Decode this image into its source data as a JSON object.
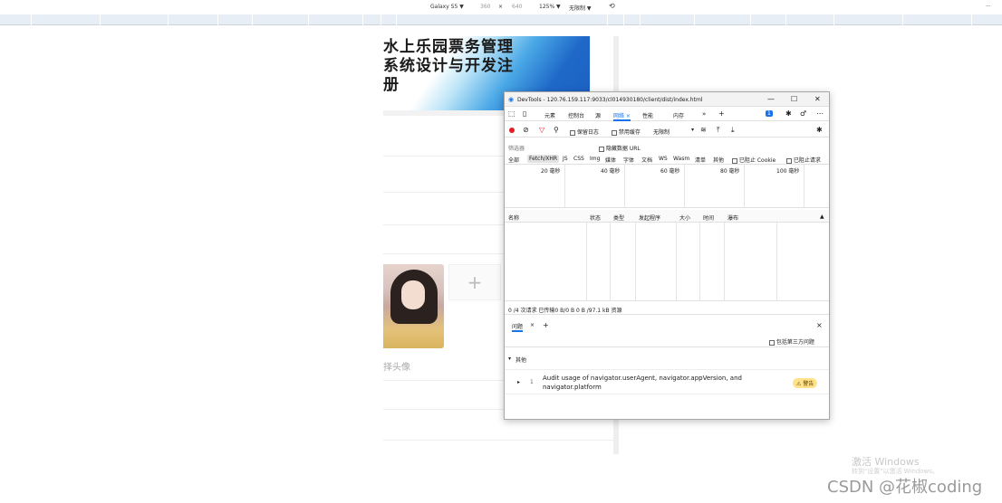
{
  "device_toolbar": {
    "device": "Galaxy S5 ▼",
    "width": "360",
    "times": "×",
    "height": "640",
    "zoom": "125% ▼",
    "throttle": "无限制 ▼",
    "more": "···"
  },
  "page": {
    "banner_title": "水上乐园票务管理系统设计与开发注册",
    "add_icon": "+",
    "avatar_label": "择头像"
  },
  "devtools": {
    "title": "DevTools - 120.76.159.117:9033/cl014930180/client/dist/index.html",
    "window_controls": {
      "minimize": "—",
      "maximize": "☐",
      "close": "✕"
    },
    "tabs": [
      "元素",
      "控制台",
      "源",
      "网络 ×",
      "性能",
      "内存",
      "»",
      "+"
    ],
    "issue_count": "1",
    "net_toolbar": {
      "preserve_log": "保留日志",
      "disable_cache": "禁用缓存",
      "throttle": "无限制"
    },
    "filter": {
      "placeholder": "筛选器",
      "hide_data_urls": "隐藏数据 URL"
    },
    "types": [
      "全部",
      "Fetch/XHR",
      "JS",
      "CSS",
      "Img",
      "媒体",
      "字体",
      "文档",
      "WS",
      "Wasm",
      "清单",
      "其他"
    ],
    "blocked_cookies": "已阻止 Cookie",
    "blocked_requests": "已阻止请求",
    "timeline_ticks": [
      "20 毫秒",
      "40 毫秒",
      "60 毫秒",
      "80 毫秒",
      "100 毫秒"
    ],
    "columns": [
      "名称",
      "状态",
      "类型",
      "发起程序",
      "大小",
      "时间",
      "瀑布"
    ],
    "status": "0 /4 次请求  已传输0 B/0 B  0 B /97.1 kB 资源",
    "issues": {
      "tab": "问题",
      "close": "×",
      "add": "+",
      "include_third_party": "包括第三方问题",
      "group": "其他",
      "issue_count": "1",
      "issue_text": "Audit usage of navigator.userAgent, navigator.appVersion, and navigator.platform",
      "badge": "⚠ 警告"
    }
  },
  "watermark": {
    "line1": "激活 Windows",
    "line2": "转到\"设置\"以激活 Windows。",
    "csdn": "CSDN @花椒coding"
  },
  "colors": {
    "accent": "#1a73e8",
    "record": "#e51c23",
    "warning_badge": "#ffe28a",
    "banner_blue": "#1b5fc2"
  }
}
